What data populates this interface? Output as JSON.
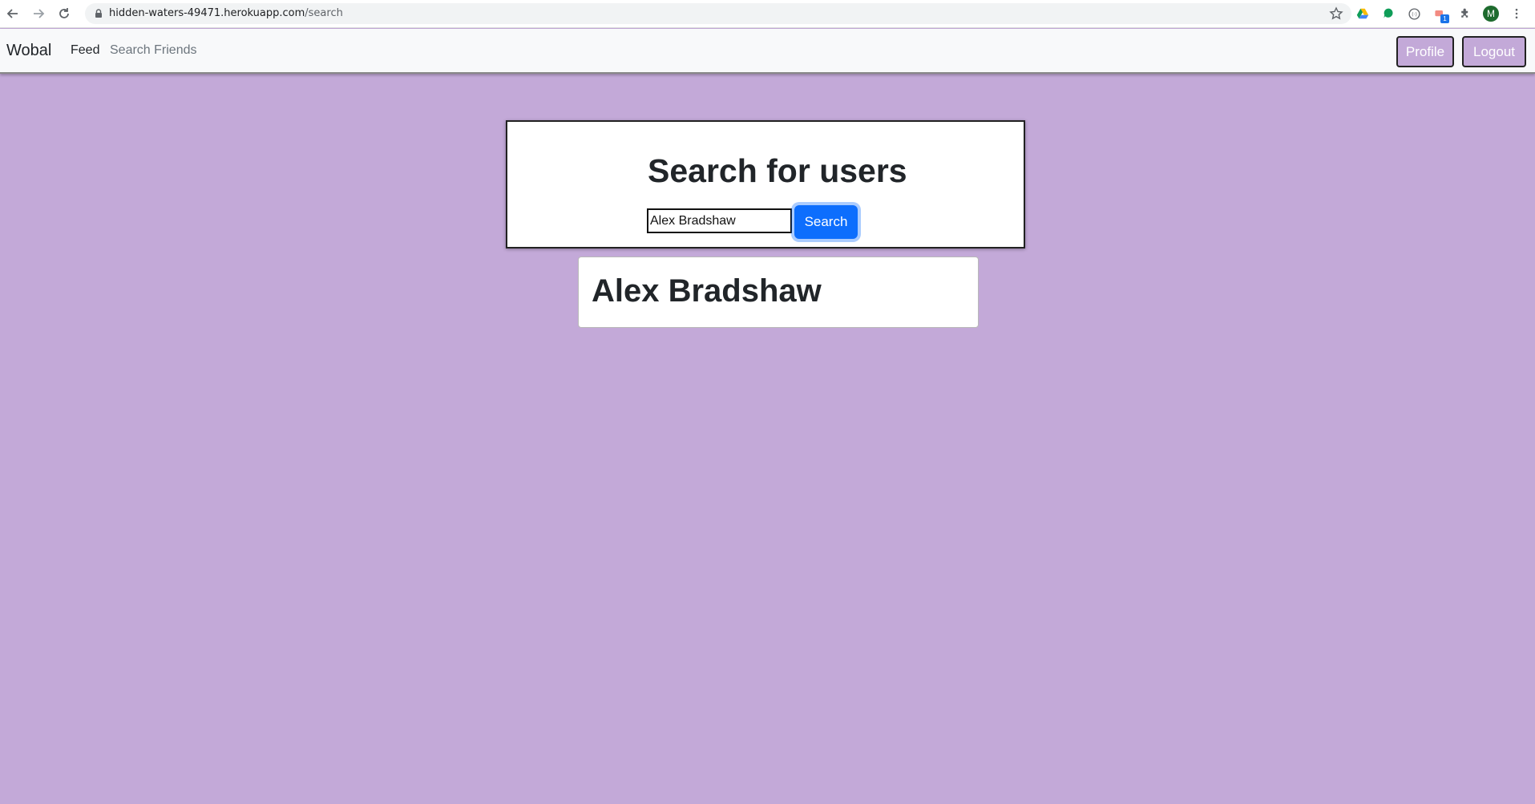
{
  "browser": {
    "url_host": "hidden-waters-49471.herokuapp.com",
    "url_path": "/search",
    "extension_badge": "1",
    "profile_initial": "M"
  },
  "navbar": {
    "brand": "Wobal",
    "links": [
      "Feed",
      "Search Friends"
    ],
    "profile_label": "Profile",
    "logout_label": "Logout"
  },
  "search": {
    "title": "Search for users",
    "input_value": "Alex Bradshaw",
    "button_label": "Search"
  },
  "results": [
    {
      "name": "Alex Bradshaw"
    }
  ],
  "colors": {
    "page_bg": "#c3a9d8",
    "primary": "#0d6efd"
  }
}
